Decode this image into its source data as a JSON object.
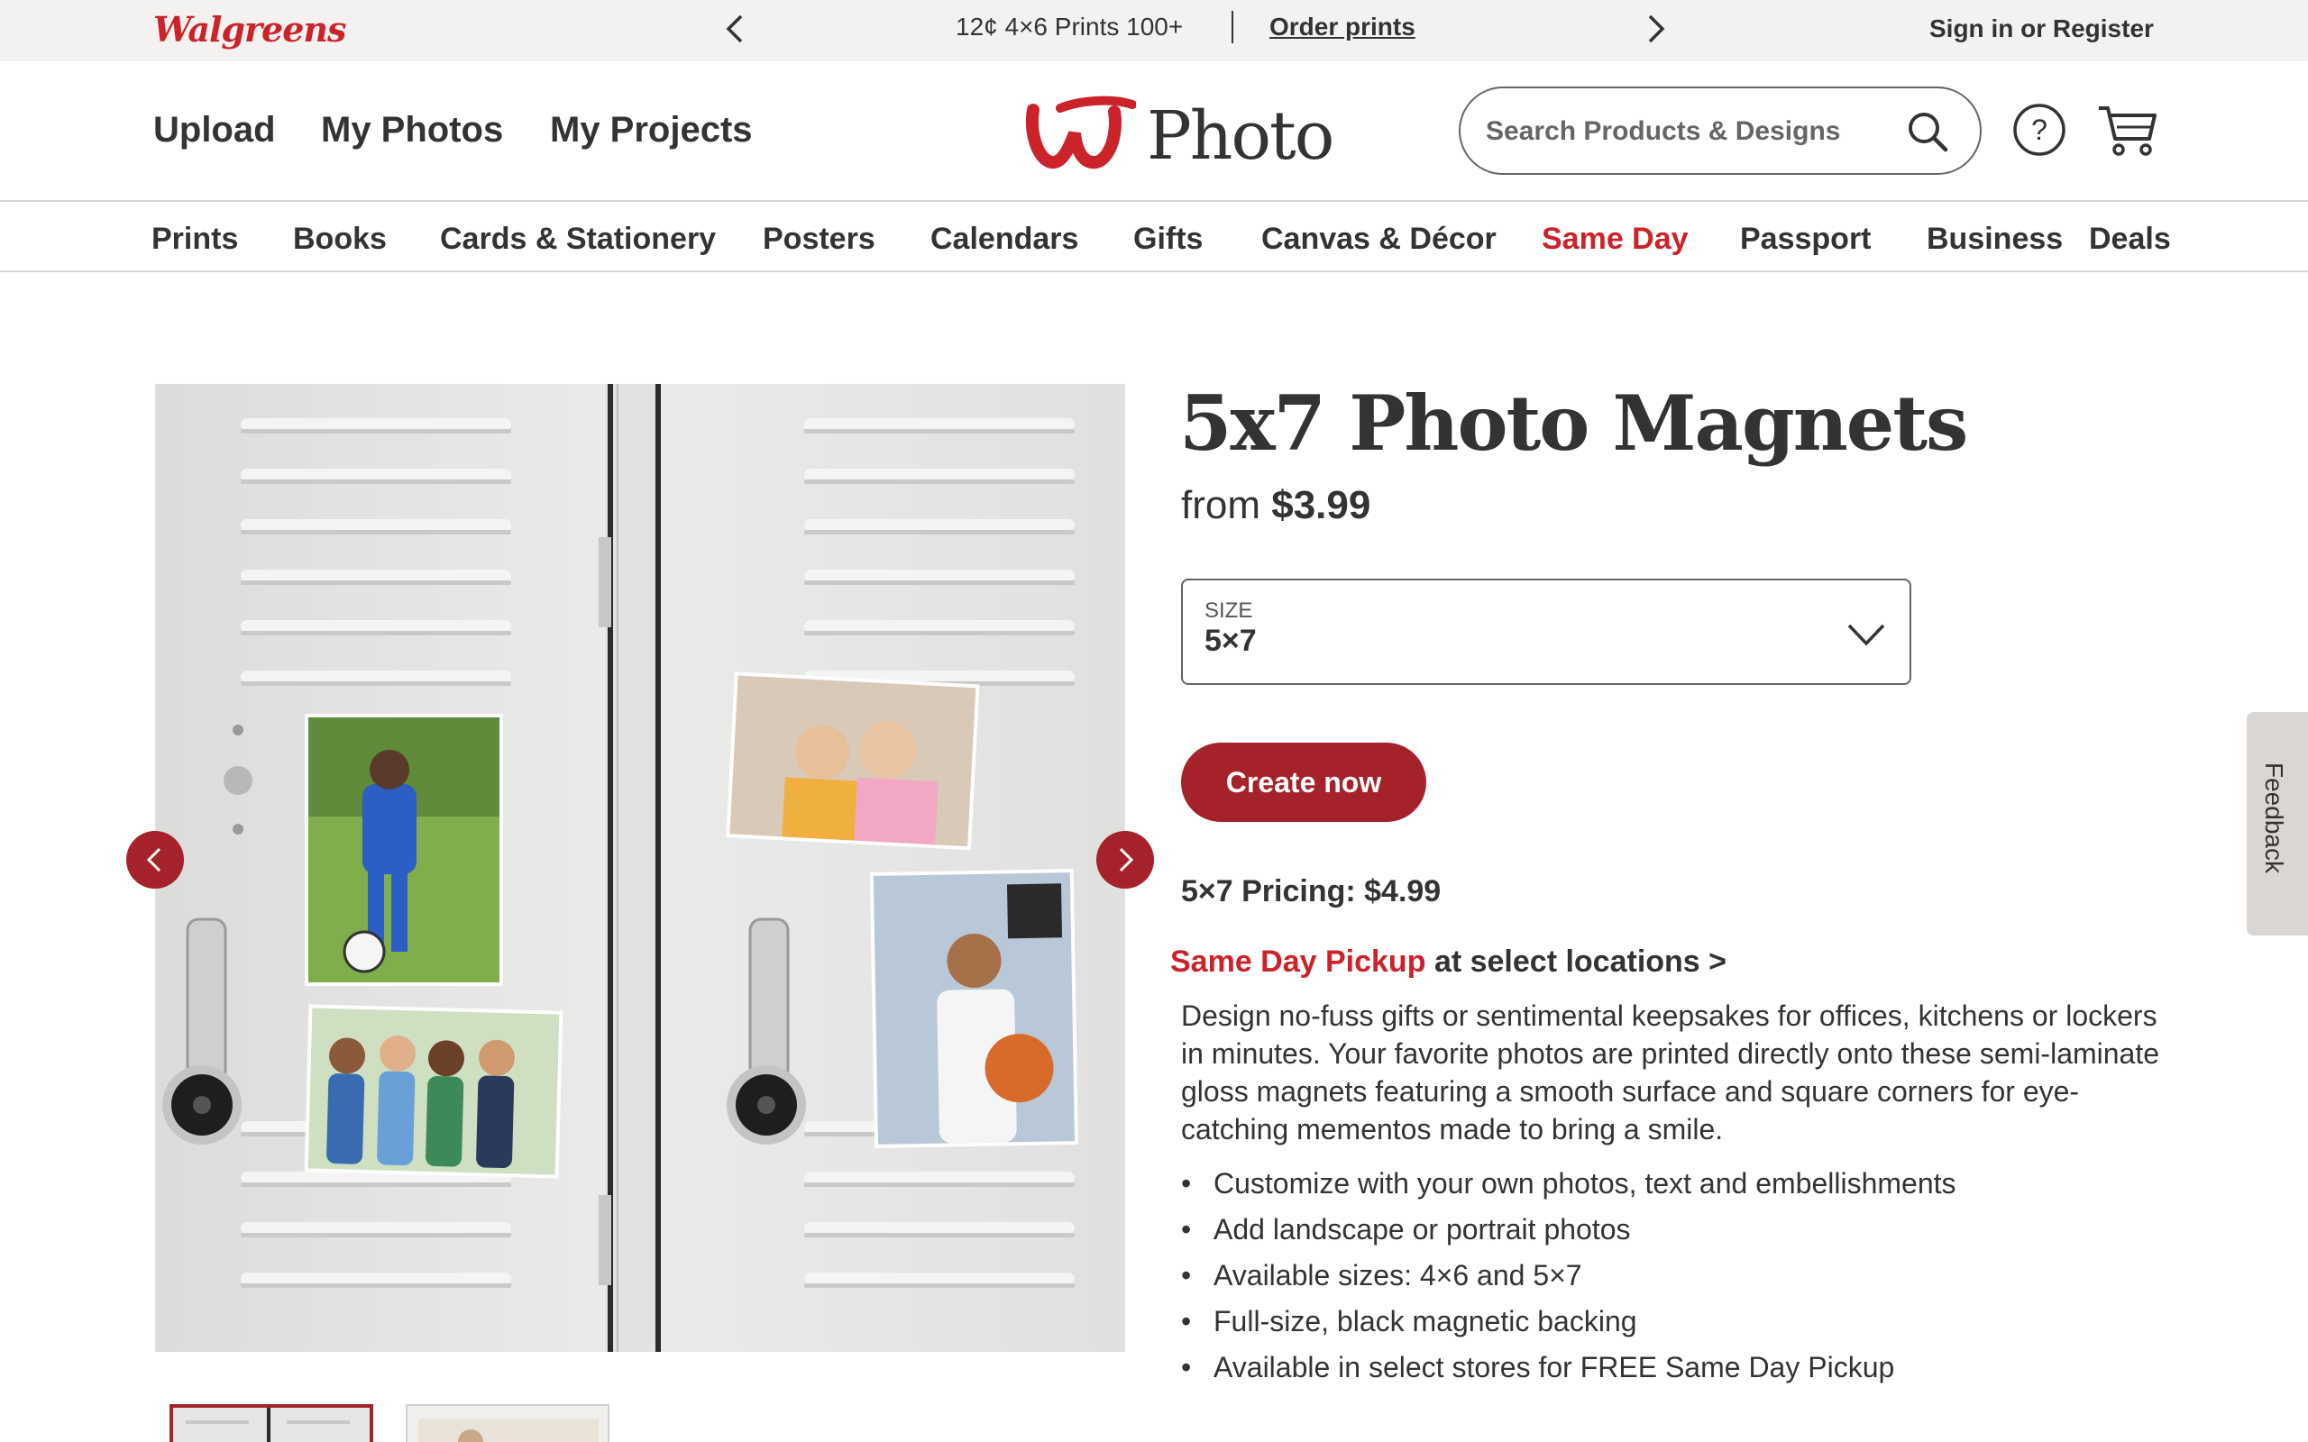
{
  "promo_bar": {
    "brand": "Walgreens",
    "message": "12¢ 4×6 Prints 100+",
    "link": "Order prints",
    "account": "Sign in or Register"
  },
  "header": {
    "nav": [
      "Upload",
      "My Photos",
      "My Projects"
    ],
    "logo_text": "Photo",
    "search_placeholder": "Search Products & Designs"
  },
  "categories": [
    {
      "label": "Prints"
    },
    {
      "label": "Books"
    },
    {
      "label": "Cards & Stationery"
    },
    {
      "label": "Posters"
    },
    {
      "label": "Calendars"
    },
    {
      "label": "Gifts"
    },
    {
      "label": "Canvas & Décor"
    },
    {
      "label": "Same Day",
      "highlighted": true
    },
    {
      "label": "Passport"
    },
    {
      "label": "Business"
    },
    {
      "label": "Deals"
    }
  ],
  "product": {
    "title": "5x7 Photo Magnets",
    "price_prefix": "from",
    "price": "$3.99",
    "size_label": "SIZE",
    "size_value": "5×7",
    "cta": "Create now",
    "pricing_note": "5×7 Pricing: $4.99",
    "pickup_highlight": "Same Day Pickup",
    "pickup_rest": "at select locations >",
    "description": "Design no-fuss gifts or sentimental keepsakes for offices, kitchens or lockers in minutes. Your favorite photos are printed directly onto these semi-laminate gloss magnets featuring a smooth surface and square corners for eye-catching mementos made to bring a smile.",
    "features": [
      "Customize with your own photos, text and embellishments",
      "Add landscape or portrait photos",
      "Available sizes: 4×6 and 5×7",
      "Full-size, black magnetic backing",
      "Available in select stores for FREE Same Day Pickup"
    ]
  },
  "feedback_tab": "Feedback",
  "colors": {
    "brand_red": "#cc2229",
    "button_red": "#a5222a",
    "promo_bg": "#f3f2f0",
    "text": "#333333"
  },
  "icons": [
    "chevron-left-icon",
    "chevron-right-icon",
    "search-icon",
    "help-icon",
    "cart-icon",
    "chevron-down-icon",
    "walgreens-w-logo"
  ]
}
